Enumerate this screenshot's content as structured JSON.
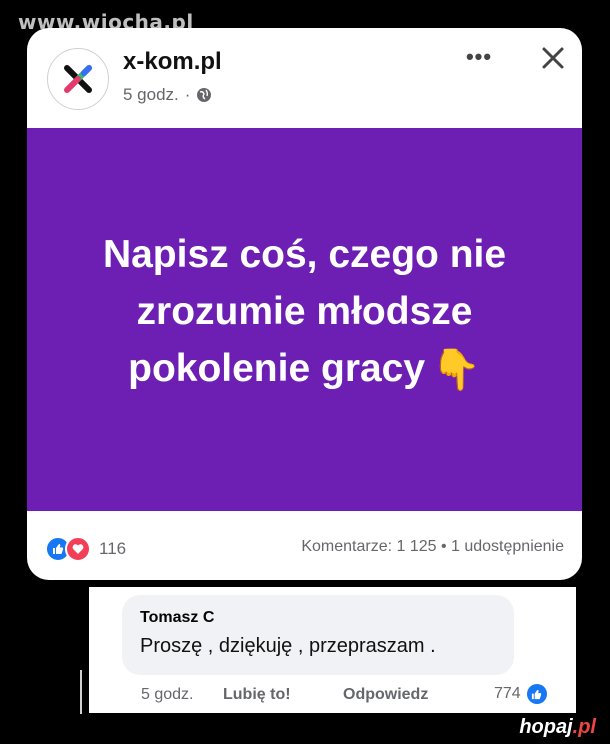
{
  "watermark": "www.wiocha.pl",
  "post": {
    "page_name": "x-kom.pl",
    "time": "5 godz.",
    "dot": "·",
    "more_label": "•••",
    "banner_lines": [
      "Napisz coś, czego nie",
      "zrozumie młodsze",
      "pokolenie gracy"
    ],
    "banner_emoji": "👇",
    "reaction_count": "116",
    "stats": "Komentarze: 1 125 • 1 udostępnienie"
  },
  "comment": {
    "author": "Tomasz C",
    "text": "Proszę , dziękuję , przepraszam .",
    "time": "5 godz.",
    "like_action": "Lubię to!",
    "reply_action": "Odpowiedz",
    "likes": "774"
  },
  "footer_logo": {
    "text": "hopaj",
    "suffix": ".pl"
  },
  "colors": {
    "banner": "#6d1fb4",
    "like_blue": "#1877f2",
    "love_red": "#f33e58"
  },
  "icons": [
    "x-kom-logo-icon",
    "globe-icon",
    "more-icon",
    "close-icon",
    "like-icon",
    "love-icon",
    "pointing-down-icon"
  ]
}
